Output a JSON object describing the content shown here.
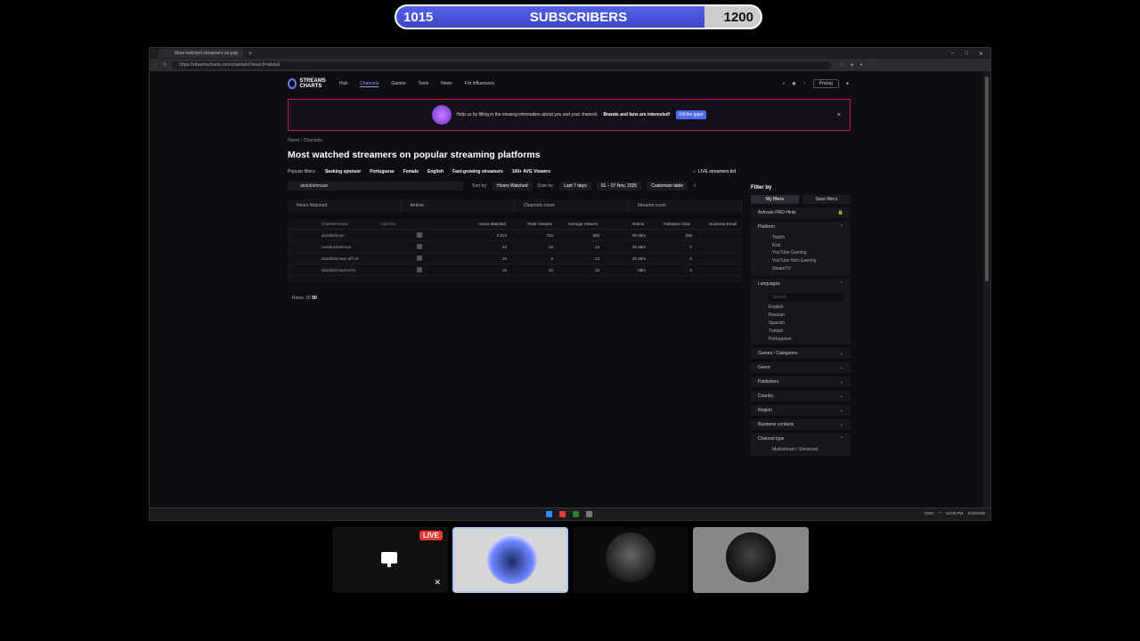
{
  "goal": {
    "current": "1015",
    "label": "SUBSCRIBERS",
    "target": "1200",
    "progress": 0.846
  },
  "browser": {
    "tab_title": "Most watched streamers on pop",
    "url": "https://streamscharts.com/channels?search=abdull"
  },
  "site": {
    "logo": "STREAMS CHARTS",
    "nav": [
      "Hub",
      "Channels",
      "Games",
      "Tools",
      "News",
      "For Influencers"
    ],
    "pricing": "Pricing"
  },
  "banner": {
    "text": "Help us by filling in the missing information about you and your channel.",
    "bold": "Brands and fans are interested!",
    "cta": "Fill the gaps",
    "close": "×"
  },
  "breadcrumb": "Home  ›  Channels",
  "title": "Most watched streamers on popular streaming platforms",
  "popular": {
    "label": "Popular filters:",
    "items": [
      "Seeking sponsor",
      "Portuguese",
      "Female",
      "English",
      "Fast-growing streamers",
      "100+ AVG Viewers"
    ],
    "live": "LIVE streamers list"
  },
  "search": {
    "value": "abdullahmaan"
  },
  "sort": {
    "sort_label": "Sort by:",
    "sort_value": "Hours Watched",
    "date_label": "Date by:",
    "date_value": "Last 7 days",
    "range": "01 – 07 Nov, 2025",
    "customize": "Customize table"
  },
  "metric_tabs": [
    "Hours Watched",
    "Airtime",
    "Channels count",
    "Streams count"
  ],
  "table": {
    "headers": [
      "Channel Name",
      "Add info",
      "Hours Watched",
      "Peak Viewers",
      "Average Viewers",
      "Airtime",
      "Followers Gain",
      "Business Email"
    ],
    "rows": [
      {
        "name": "abdullahman",
        "hw": "3 613",
        "peak": "734",
        "avg": "365",
        "air": "9h 59m",
        "fol": "255"
      },
      {
        "name": "realabdullahman",
        "hw": "60",
        "peak": "28",
        "avg": "13",
        "air": "3h 49m",
        "fol": "0"
      },
      {
        "name": "abdullahmaan-aff-19",
        "hw": "26",
        "peak": "9",
        "avg": "13",
        "air": "2h 46m",
        "fol": "0"
      },
      {
        "name": "abdullahmaanreels",
        "hw": "19",
        "peak": "22",
        "avg": "13",
        "air": "58m",
        "fol": "0"
      }
    ]
  },
  "rows_per_page": {
    "label": "Rows:",
    "opt1": "20",
    "opt2": "50"
  },
  "filters": {
    "title": "Filter by",
    "tab_my": "My filters",
    "tab_saved": "Save filters",
    "pro": "Activate PRO Hints",
    "platform": "Platform",
    "platforms": [
      "Twitch",
      "Kick",
      "YouTube Gaming",
      "YouTube Non-Gaming",
      "SteamTV"
    ],
    "languages": "Languages",
    "search_placeholder": "Search",
    "langs": [
      "English",
      "Russian",
      "Spanish",
      "Turkish",
      "Portuguese"
    ],
    "sections": [
      "Games / Categories",
      "Genre",
      "Publishers",
      "Country",
      "Region",
      "Business contacts",
      "Channel type"
    ],
    "channel_type_sub": "Multistream / Simulcast"
  },
  "taskbar": {
    "clock": "12:05 PM",
    "date": "11/8/2025",
    "lang": "ENG"
  },
  "call": {
    "live_badge": "LIVE",
    "mute_icon": "muted-mic-icon"
  }
}
